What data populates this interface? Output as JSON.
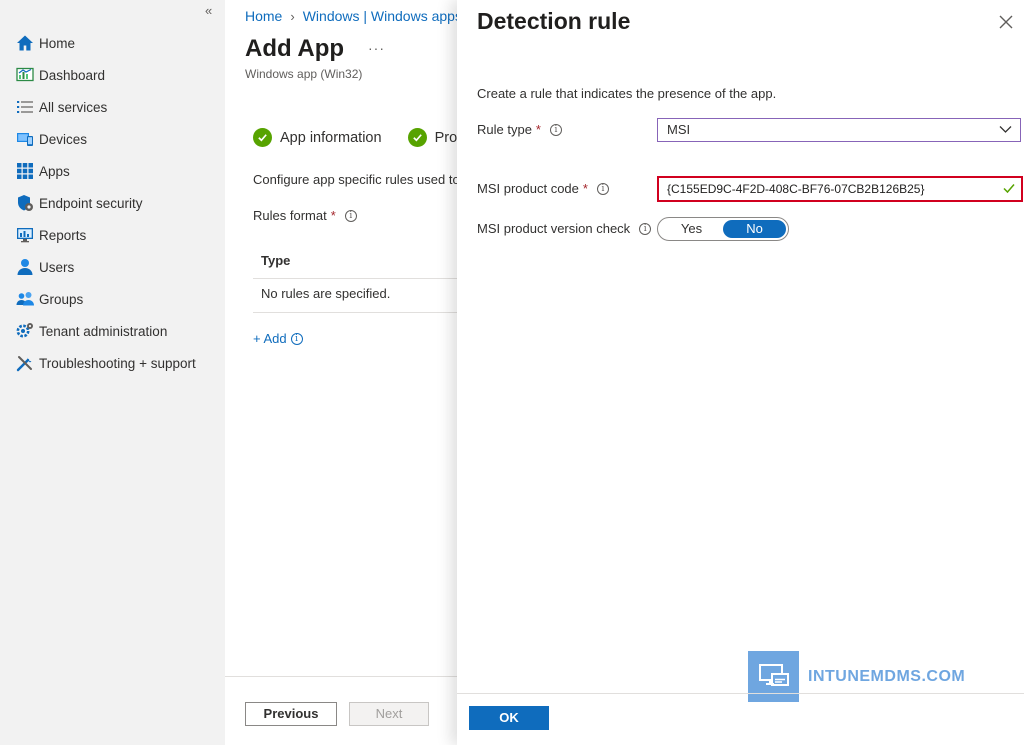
{
  "sidebar": {
    "collapse_label": "«",
    "items": [
      {
        "label": "Home",
        "icon": "home-icon"
      },
      {
        "label": "Dashboard",
        "icon": "dashboard-icon"
      },
      {
        "label": "All services",
        "icon": "list-icon"
      },
      {
        "label": "Devices",
        "icon": "devices-icon"
      },
      {
        "label": "Apps",
        "icon": "apps-grid-icon"
      },
      {
        "label": "Endpoint security",
        "icon": "shield-icon"
      },
      {
        "label": "Reports",
        "icon": "reports-icon"
      },
      {
        "label": "Users",
        "icon": "user-icon"
      },
      {
        "label": "Groups",
        "icon": "groups-icon"
      },
      {
        "label": "Tenant administration",
        "icon": "tenant-gear-icon"
      },
      {
        "label": "Troubleshooting + support",
        "icon": "wrench-icon"
      }
    ]
  },
  "main": {
    "breadcrumb": [
      "Home",
      "Windows | Windows apps"
    ],
    "title": "Add App",
    "more_label": "···",
    "subtitle": "Windows app (Win32)",
    "steps": [
      "App information",
      "Program"
    ],
    "description": "Configure app specific rules used to detect the presence of the app.",
    "rules_format_label": "Rules format",
    "required_marker": "*",
    "table": {
      "header": "Type",
      "empty_message": "No rules are specified."
    },
    "add_link": "+ Add",
    "previous_label": "Previous",
    "next_label": "Next"
  },
  "panel": {
    "title": "Detection rule",
    "description": "Create a rule that indicates the presence of the app.",
    "rule_type_label": "Rule type",
    "rule_type_value": "MSI",
    "product_code_label": "MSI product code",
    "product_code_value": "{C155ED9C-4F2D-408C-BF76-07CB2B126B25}",
    "version_check_label": "MSI product version check",
    "toggle_yes": "Yes",
    "toggle_no": "No",
    "toggle_selected": "No",
    "ok_label": "OK",
    "watermark": "INTUNEMDMS.COM"
  },
  "colors": {
    "accent": "#0f6cbd",
    "success": "#57a300",
    "error_outline": "#d1001f",
    "select_border": "#8764b8",
    "watermark": "#6fa6e0"
  }
}
